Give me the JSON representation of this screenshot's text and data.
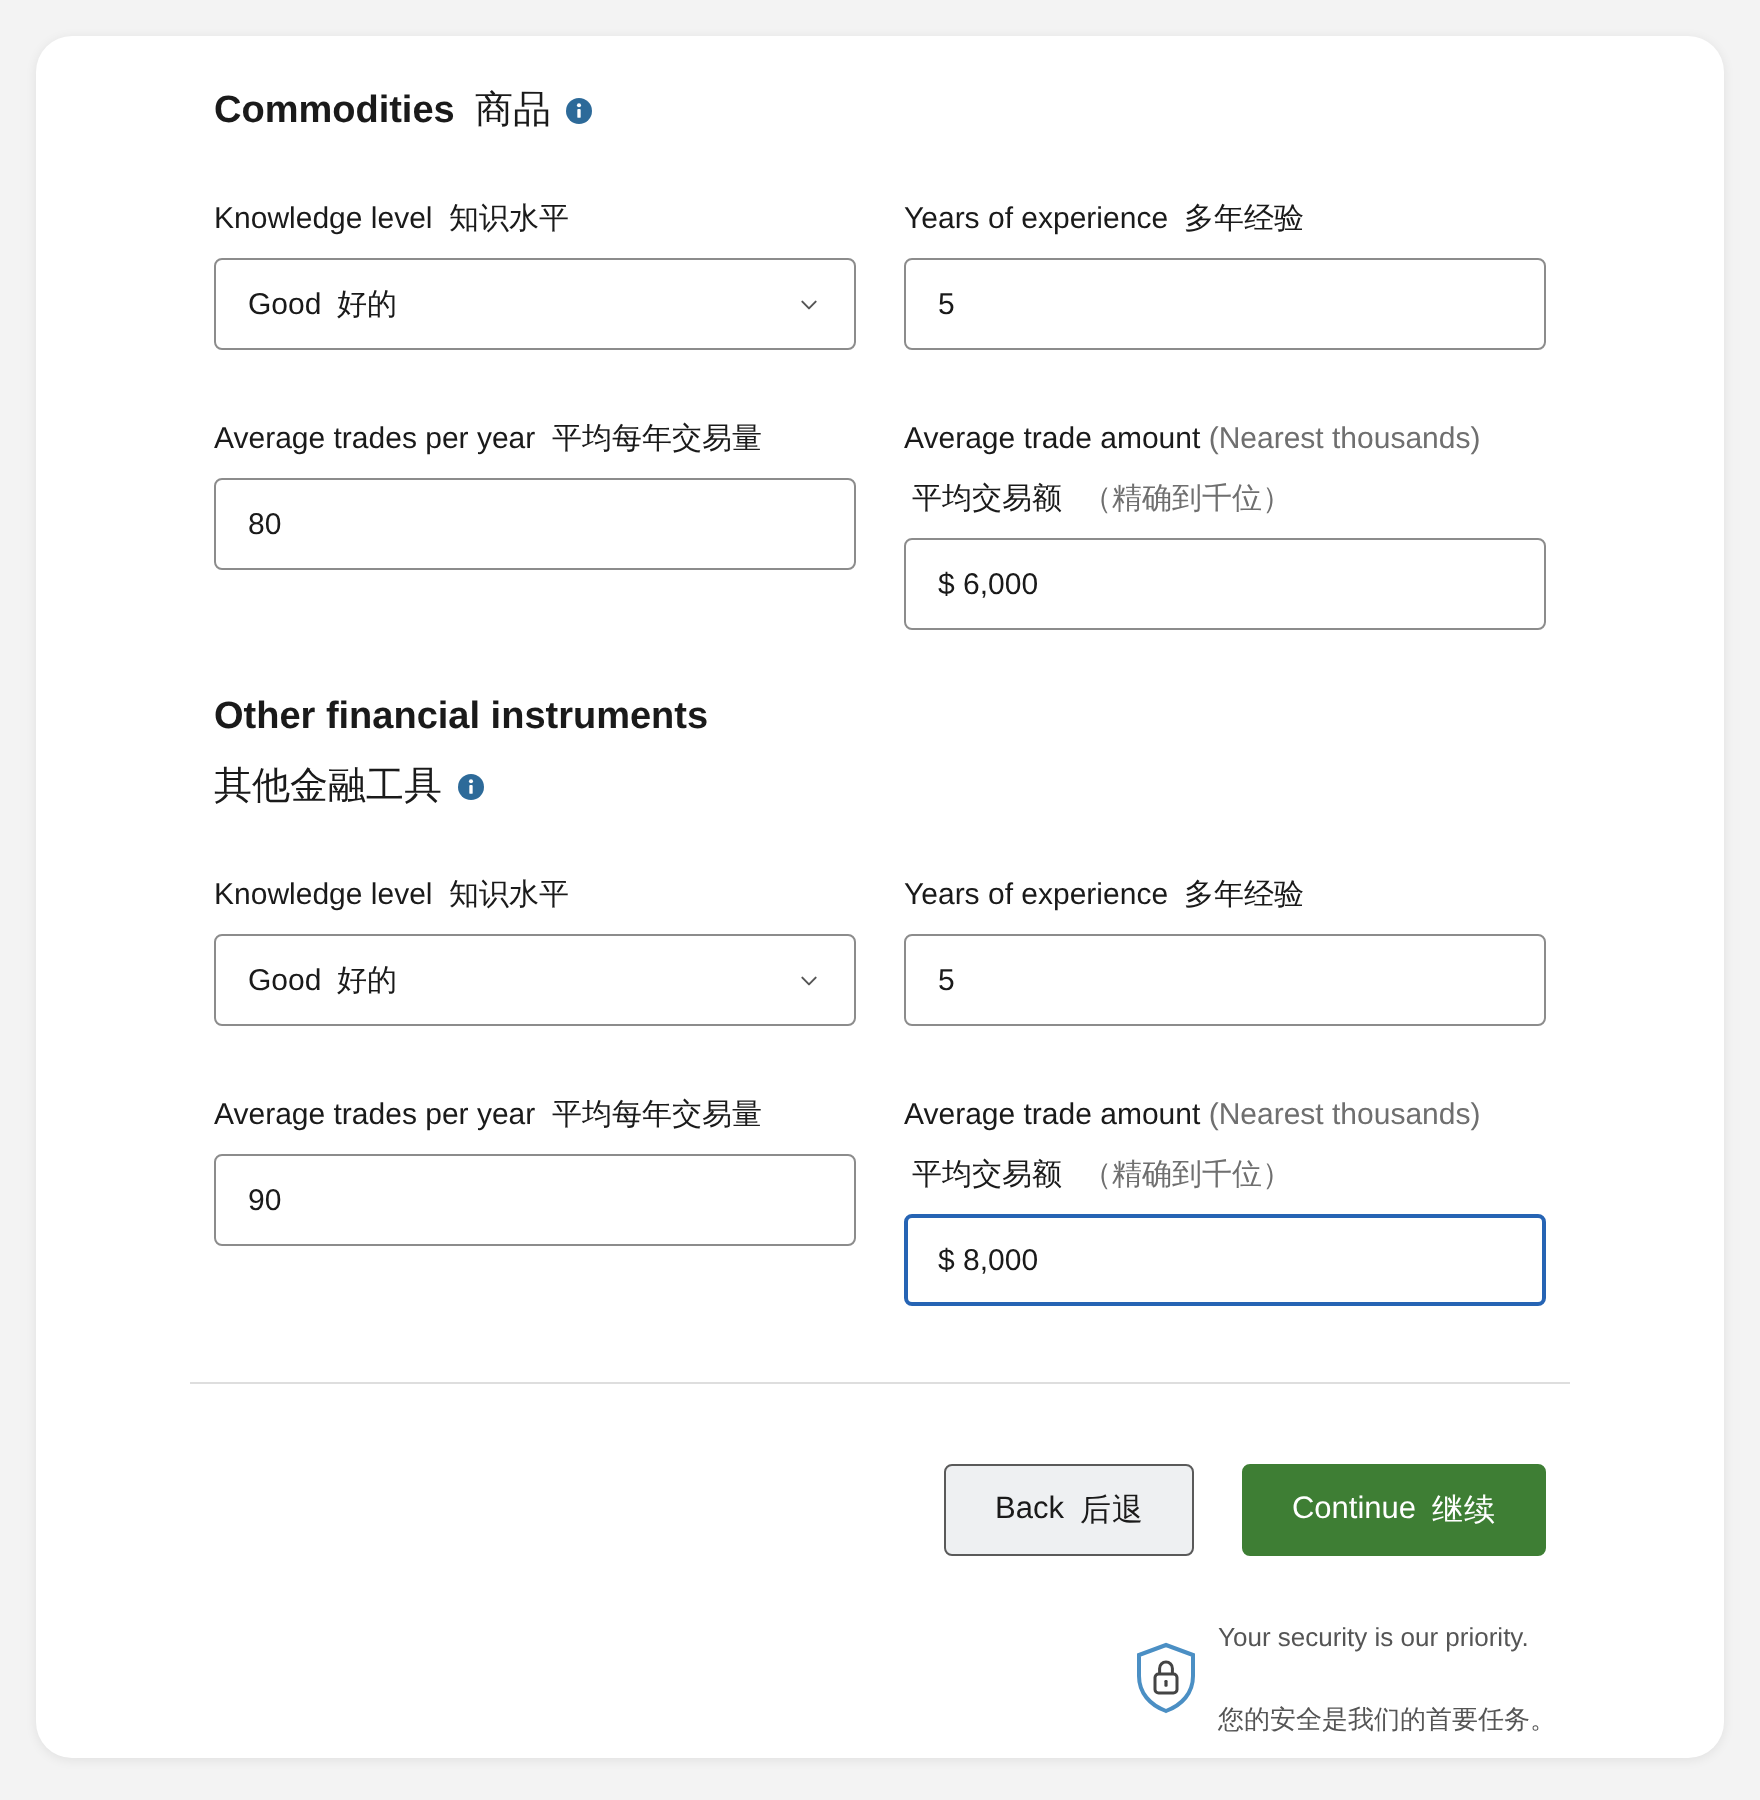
{
  "sections": [
    {
      "title": "Commodities",
      "title_zh": "商品",
      "fields": [
        {
          "kind": "select",
          "label": "Knowledge level",
          "label_zh": "知识水平",
          "value": "Good",
          "value_zh": "好的",
          "focused": false
        },
        {
          "kind": "text",
          "label": "Years of experience",
          "label_zh": "多年经验",
          "value": "5",
          "focused": false
        },
        {
          "kind": "text",
          "label": "Average trades per year",
          "label_zh": "平均每年交易量",
          "value": "80",
          "focused": false
        },
        {
          "kind": "text",
          "label": "Average trade amount",
          "hint": "(Nearest thousands)",
          "label_zh": "平均交易额",
          "hint_zh": "（精确到千位）",
          "value": "$ 6,000",
          "focused": false
        }
      ]
    },
    {
      "title": "Other financial instruments",
      "title_zh": "其他金融工具",
      "fields": [
        {
          "kind": "select",
          "label": "Knowledge level",
          "label_zh": "知识水平",
          "value": "Good",
          "value_zh": "好的",
          "focused": false
        },
        {
          "kind": "text",
          "label": "Years of experience",
          "label_zh": "多年经验",
          "value": "5",
          "focused": false
        },
        {
          "kind": "text",
          "label": "Average trades per year",
          "label_zh": "平均每年交易量",
          "value": "90",
          "focused": false
        },
        {
          "kind": "text",
          "label": "Average trade amount",
          "hint": "(Nearest thousands)",
          "label_zh": "平均交易额",
          "hint_zh": "（精确到千位）",
          "value": "$ 8,000",
          "focused": true
        }
      ]
    }
  ],
  "buttons": [
    {
      "kind": "secondary",
      "label": "Back",
      "label_zh": "后退"
    },
    {
      "kind": "primary",
      "label": "Continue",
      "label_zh": "继续"
    }
  ],
  "security": {
    "text": "Your security is our priority.",
    "text_zh": "您的安全是我们的首要任务。"
  }
}
